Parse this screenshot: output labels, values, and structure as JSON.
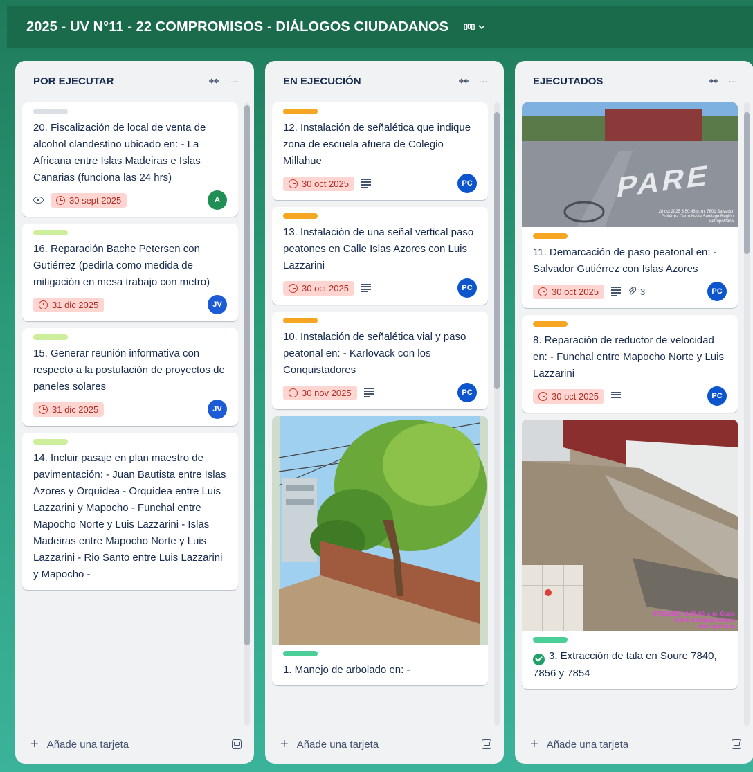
{
  "board": {
    "title": "2025 - UV N°11 - 22 COMPROMISOS - DIÁLOGOS CIUDADANOS",
    "view_icon": "board-view-icon"
  },
  "colors": {
    "red_due_bg": "#ffd5d2",
    "red_due_text": "#ae2e24",
    "label_gray": "#dcdfe4",
    "label_lime": "#cdef9c",
    "label_orange": "#f5a623",
    "label_green": "#4bce97"
  },
  "footer": {
    "add_card": "Añade una tarjeta"
  },
  "columns": [
    {
      "title": "POR EJECUTAR",
      "cards": [
        {
          "title": "20. Fiscalización de local de venta de alcohol clandestino ubicado en: - La Africana entre Islas Madeiras e Islas Canarias (funciona las 24 hrs)",
          "due": "30 sept 2025",
          "avatar": "A"
        },
        {
          "title": "16. Reparación Bache Petersen con Gutiérrez (pedirla como medida de mitigación en mesa trabajo con metro)",
          "due": "31 dic 2025",
          "avatar": "JV"
        },
        {
          "title": "15. Generar reunión informativa con respecto a la postulación de proyectos de paneles solares",
          "due": "31 dic 2025",
          "avatar": "JV"
        },
        {
          "title": "14. Incluir pasaje en plan maestro de pavimentación: - Juan Bautista entre Islas Azores y Orquídea - Orquídea entre Luis Lazzarini y Mapocho - Funchal entre Mapocho Norte y Luis Lazzarini - Islas Madeiras entre Mapocho Norte y Luis Lazzarini - Rio Santo entre Luis Lazzarini y Mapocho -"
        }
      ]
    },
    {
      "title": "EN EJECUCIÓN",
      "cards": [
        {
          "title": "12. Instalación de señalética que indique zona de escuela afuera de Colegio Millahue",
          "due": "30 oct 2025",
          "avatar": "PC"
        },
        {
          "title": "13. Instalación de una señal vertical paso peatones en Calle Islas Azores con Luis Lazzarini",
          "due": "30 oct 2025",
          "avatar": "PC"
        },
        {
          "title": "10. Instalación de señalética vial y paso peatonal en: - Karlovack con los Conquistadores",
          "due": "30 nov 2025",
          "avatar": "PC"
        },
        {
          "title": "1. Manejo de arbolado en: -"
        }
      ]
    },
    {
      "title": "EJECUTADOS",
      "cards": [
        {
          "title": "11. Demarcación de paso peatonal en: - Salvador Gutiérrez con Islas Azores",
          "due": "30 oct 2025",
          "attachments": "3",
          "avatar": "PC",
          "cover_text": "PARE",
          "cover_caption": "28 oct 2025 3:50:46 p. m. 7601 Salvador Gutiérrez Cerro Navia Santiago Región Metropolitana"
        },
        {
          "title": "8. Reparación de reductor de velocidad en: - Funchal entre Mapocho Norte y Luis Lazzarini",
          "due": "30 oct 2025",
          "avatar": "PC"
        },
        {
          "title": "3. Extracción de tala en Soure 7840, 7856 y 7854",
          "cover_caption": "07/11/2025 10:18:06 a. m. Cerro Navia Santiago Región Metropolitana"
        }
      ]
    }
  ]
}
